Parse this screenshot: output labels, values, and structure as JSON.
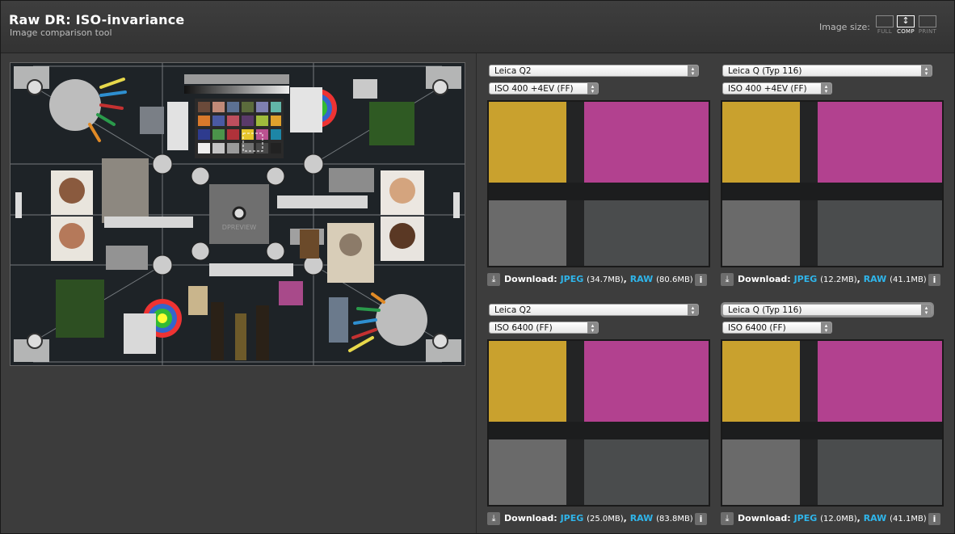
{
  "header": {
    "title": "Raw DR: ISO-invariance",
    "subtitle": "Image comparison tool",
    "image_size_label": "Image size:",
    "size_options": [
      {
        "label": "FULL",
        "active": false
      },
      {
        "label": "COMP",
        "active": true
      },
      {
        "label": "PRINT",
        "active": false
      }
    ]
  },
  "main_image": {
    "chart_brand": "DPREVIEW"
  },
  "panels": [
    {
      "camera": "Leica Q2",
      "setting": "ISO 400 +4EV (FF)",
      "download_label": "Download:",
      "jpeg_label": "JPEG",
      "jpeg_size": "(34.7MB)",
      "raw_label": "RAW",
      "raw_size": "(80.6MB)",
      "info_label": "i"
    },
    {
      "camera": "Leica Q (Typ 116)",
      "setting": "ISO 400 +4EV (FF)",
      "download_label": "Download:",
      "jpeg_label": "JPEG",
      "jpeg_size": "(12.2MB)",
      "raw_label": "RAW",
      "raw_size": "(41.1MB)",
      "info_label": "i"
    },
    {
      "camera": "Leica Q2",
      "setting": "ISO 6400 (FF)",
      "download_label": "Download:",
      "jpeg_label": "JPEG",
      "jpeg_size": "(25.0MB)",
      "raw_label": "RAW",
      "raw_size": "(83.8MB)",
      "info_label": "i"
    },
    {
      "camera": "Leica Q (Typ 116)",
      "setting": "ISO 6400 (FF)",
      "download_label": "Download:",
      "jpeg_label": "JPEG",
      "jpeg_size": "(12.0MB)",
      "raw_label": "RAW",
      "raw_size": "(41.1MB)",
      "info_label": "i"
    }
  ],
  "colors": {
    "link": "#2fb5ea",
    "yellow_patch": "#c9a12e",
    "magenta_patch": "#b2418f"
  }
}
